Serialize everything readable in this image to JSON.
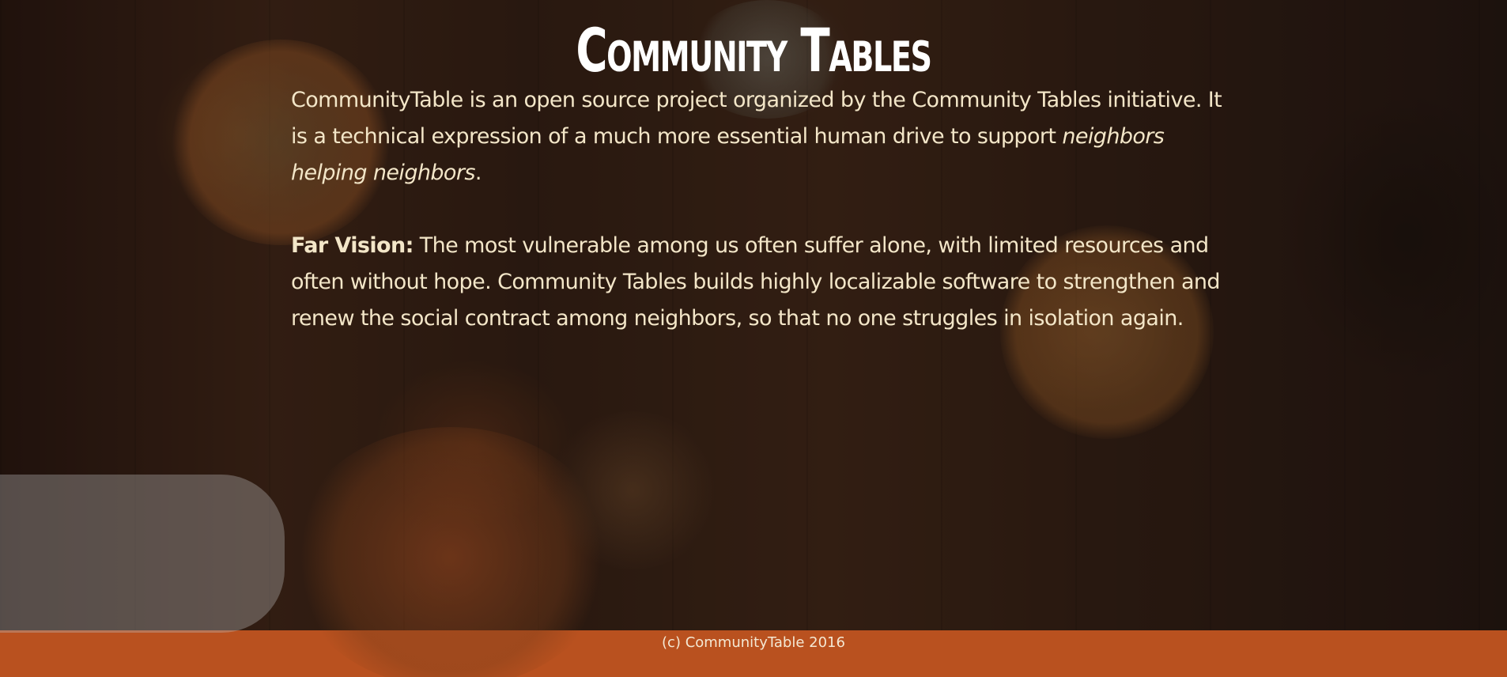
{
  "header": {
    "title": "Community Tables"
  },
  "intro": {
    "text_before": "CommunityTable is an open source project organized by the Community Tables initiative. It is a technical expression of a much more essential human drive to support ",
    "emphasis": "neighbors helping neighbors",
    "text_after": "."
  },
  "vision": {
    "label": "Far Vision:",
    "text": " The most vulnerable among us often suffer alone, with limited resources and often without hope. Community Tables builds highly localizable software to strengthen and renew the social contract among neighbors, so that no one struggles in isolation again."
  },
  "footer": {
    "copyright": "(c) CommunityTable 2016"
  },
  "colors": {
    "footer_background": "#b9511f",
    "body_text": "#f3e6c8",
    "title_text": "#ffffff"
  }
}
